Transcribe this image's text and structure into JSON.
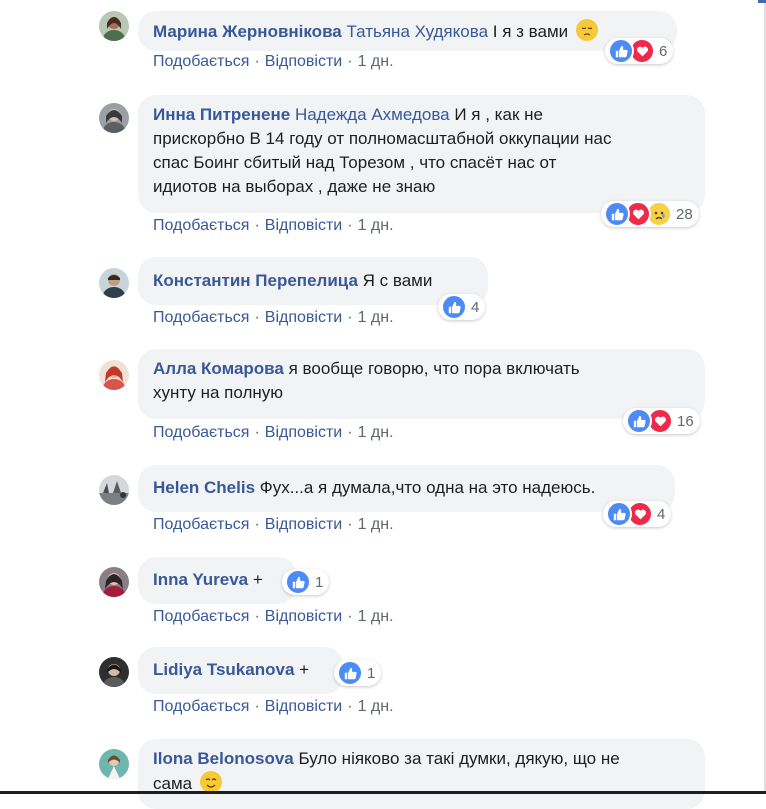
{
  "actions": {
    "like": "Подобається",
    "reply": "Відповісти",
    "sep": "·"
  },
  "comments": [
    {
      "author": "Марина Жерновнікова",
      "tag": "Татьяна Худякова",
      "text": "I я з вами",
      "emoji": "pensive-emoji",
      "time": "1 дн.",
      "reactions": [
        "like",
        "love"
      ],
      "count": "6"
    },
    {
      "author": "Инна Питренене",
      "tag": "Надежда Ахмедова",
      "text_lines": [
        "И я , как не",
        "прискорбно В 14 году от полномасштабной оккупации нас",
        "спас Боинг сбитый над Торезом , что спасёт нас от",
        "идиотов на выборах , даже не знаю"
      ],
      "time": "1 дн.",
      "reactions": [
        "like",
        "love",
        "sad"
      ],
      "count": "28"
    },
    {
      "author": "Константин Перепелица",
      "text": "Я с вами",
      "time": "1 дн.",
      "reactions": [
        "like"
      ],
      "count": "4"
    },
    {
      "author": "Алла Комарова",
      "text_lines": [
        "я вообще говорю, что пора включать",
        "хунту на полную"
      ],
      "time": "1 дн.",
      "reactions": [
        "like",
        "love"
      ],
      "count": "16"
    },
    {
      "author": "Helen Chelis",
      "text": "Фух...а я думала,что одна на это надеюсь.",
      "time": "1 дн.",
      "reactions": [
        "like",
        "love"
      ],
      "count": "4"
    },
    {
      "author": "Inna Yureva",
      "text": "+",
      "time": "1 дн.",
      "reactions": [
        "like"
      ],
      "count": "1"
    },
    {
      "author": "Lidiya Tsukanova",
      "text": "+",
      "time": "1 дн.",
      "reactions": [
        "like"
      ],
      "count": "1"
    },
    {
      "author": "Ilona Belonosova",
      "text_lines": [
        "Було ніяково за такі думки, дякую, що не",
        "сама"
      ],
      "emoji": "smile-emoji"
    }
  ],
  "colors": {
    "link": "#385898",
    "bubble": "#f2f3f5",
    "like": "#4c8bf5",
    "love": "#f0284a",
    "sad": "#f7d046"
  }
}
